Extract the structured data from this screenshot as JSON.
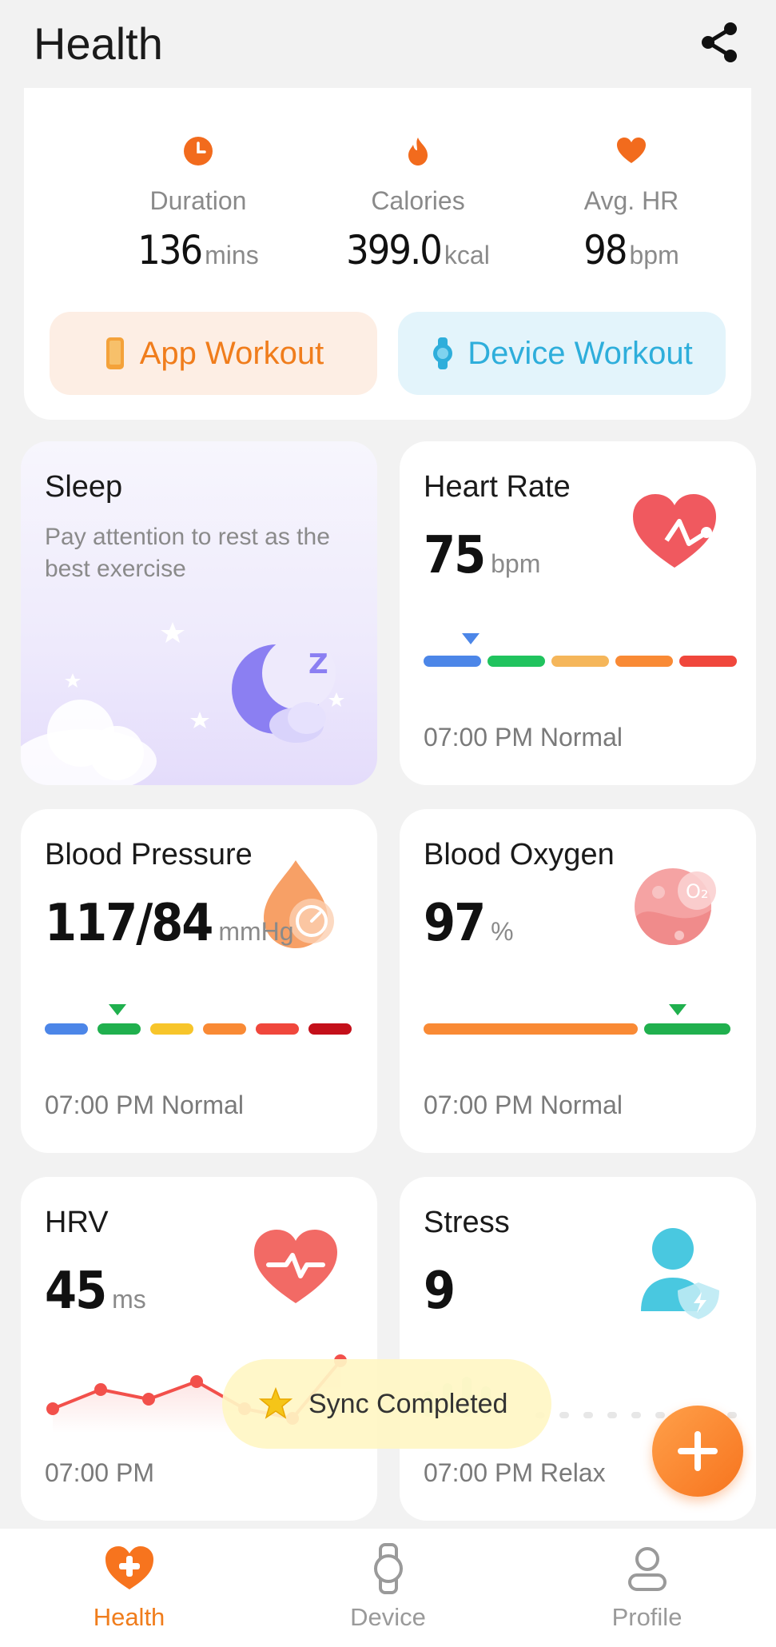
{
  "header": {
    "title": "Health"
  },
  "summary": {
    "stats": [
      {
        "label": "Duration",
        "value": "136",
        "unit": "mins",
        "icon": "clock-icon",
        "color": "#f26b1d"
      },
      {
        "label": "Calories",
        "value": "399.0",
        "unit": "kcal",
        "icon": "flame-icon",
        "color": "#f26b1d"
      },
      {
        "label": "Avg. HR",
        "value": "98",
        "unit": "bpm",
        "icon": "heart-icon",
        "color": "#f26b1d"
      }
    ],
    "app_workout": "App Workout",
    "device_workout": "Device Workout"
  },
  "sleep": {
    "title": "Sleep",
    "subtitle": "Pay attention to rest as the best exercise"
  },
  "heart_rate": {
    "title": "Heart Rate",
    "value": "75",
    "unit": "bpm",
    "footer": "07:00 PM Normal"
  },
  "blood_pressure": {
    "title": "Blood Pressure",
    "value": "117/84",
    "unit": "mmHg",
    "footer": "07:00 PM Normal"
  },
  "blood_oxygen": {
    "title": "Blood Oxygen",
    "value": "97",
    "unit": "%",
    "footer": "07:00 PM Normal"
  },
  "hrv": {
    "title": "HRV",
    "value": "45",
    "unit": "ms",
    "footer": "07:00 PM"
  },
  "stress": {
    "title": "Stress",
    "value": "9",
    "unit": "",
    "footer": "07:00 PM Relax"
  },
  "toast": {
    "text": "Sync Completed"
  },
  "nav": {
    "tabs": [
      {
        "label": "Health",
        "icon": "heart-plus-icon",
        "active": true
      },
      {
        "label": "Device",
        "icon": "watch-icon",
        "active": false
      },
      {
        "label": "Profile",
        "icon": "person-icon",
        "active": false
      }
    ]
  },
  "colors": {
    "accent": "#f07d1c",
    "device_accent": "#2eaedb"
  }
}
